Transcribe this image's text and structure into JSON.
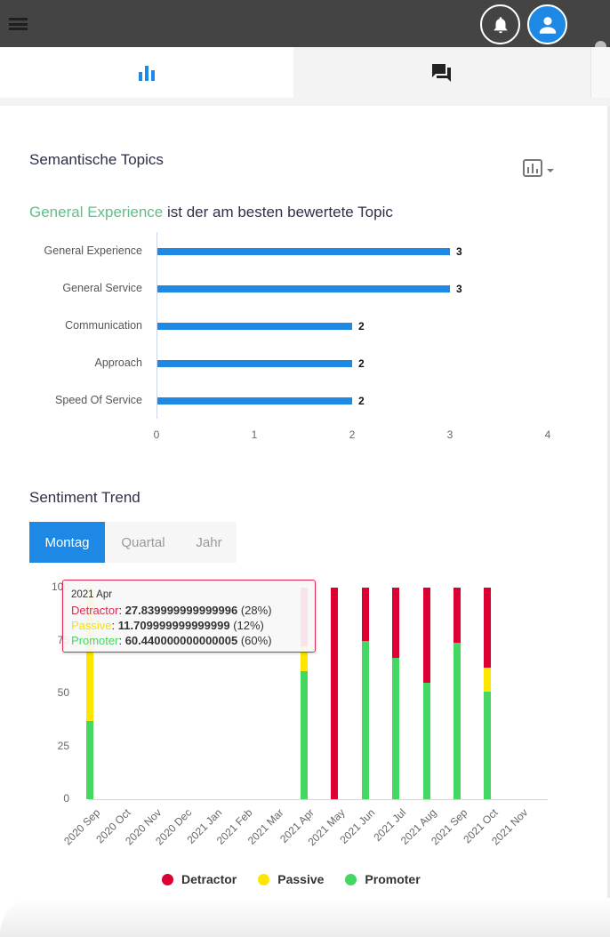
{
  "header": {
    "menu_icon": "hamburger-icon",
    "notifications_icon": "bell-icon",
    "profile_icon": "user-icon"
  },
  "tabs": [
    {
      "icon": "bar-chart-icon",
      "active": true
    },
    {
      "icon": "chat-icon",
      "active": false
    }
  ],
  "topics": {
    "title": "Semantische Topics",
    "chart_switch_icon": "bar-chart-box-icon",
    "best_topic": "General Experience",
    "best_topic_suffix": " ist der am besten bewertete Topic"
  },
  "sentiment": {
    "title": "Sentiment Trend",
    "toggles": [
      "Montag",
      "Quartal",
      "Jahr"
    ],
    "active_toggle": "Montag",
    "tooltip": {
      "header": "2021 Apr",
      "rows": [
        {
          "name": "Detractor",
          "value": "27.839999999999996",
          "pct": "(28%)",
          "color": "#e0294f"
        },
        {
          "name": "Passive",
          "value": "11.709999999999999",
          "pct": "(12%)",
          "color": "#f5e400"
        },
        {
          "name": "Promoter",
          "value": "60.440000000000005",
          "pct": "(60%)",
          "color": "#44d862"
        }
      ]
    }
  },
  "colors": {
    "accent": "#1e88e5",
    "detractor": "#dc0032",
    "passive": "#ffe600",
    "promoter": "#44d862",
    "header_bg": "#444444"
  },
  "chart_data": [
    {
      "type": "bar",
      "orientation": "horizontal",
      "title": "Semantische Topics",
      "categories": [
        "General Experience",
        "General Service",
        "Communication",
        "Approach",
        "Speed Of Service"
      ],
      "values": [
        3,
        3,
        2,
        2,
        2
      ],
      "xlim": [
        0,
        4
      ],
      "xticks": [
        "0",
        "1",
        "2",
        "3",
        "4"
      ],
      "data_labels": true,
      "grid": false
    },
    {
      "type": "bar",
      "stacked": true,
      "title": "Sentiment Trend",
      "categories": [
        "2020 Sep",
        "2020 Oct",
        "2020 Nov",
        "2020 Dec",
        "2021 Jan",
        "2021 Feb",
        "2021 Mar",
        "2021 Apr",
        "2021 May",
        "2021 Jun",
        "2021 Jul",
        "2021 Aug",
        "2021 Sep",
        "2021 Oct",
        "2021 Nov"
      ],
      "series": [
        {
          "name": "Promoter",
          "color": "#44d862",
          "values": [
            37,
            0,
            0,
            0,
            0,
            0,
            0,
            60.44,
            0,
            75,
            67,
            55,
            74,
            51,
            0
          ]
        },
        {
          "name": "Passive",
          "color": "#ffe600",
          "values": [
            63,
            0,
            0,
            0,
            0,
            0,
            0,
            11.71,
            0,
            0,
            0,
            0,
            0,
            11,
            0
          ]
        },
        {
          "name": "Detractor",
          "color": "#dc0032",
          "values": [
            0,
            0,
            0,
            0,
            0,
            0,
            0,
            27.84,
            100,
            25,
            33,
            45,
            26,
            38,
            0
          ]
        }
      ],
      "ylim": [
        0,
        100
      ],
      "yticks": [
        "0",
        "25",
        "50",
        "75",
        "100"
      ],
      "legend": {
        "position": "bottom",
        "entries": [
          "Detractor",
          "Passive",
          "Promoter"
        ]
      },
      "grid": false
    }
  ]
}
